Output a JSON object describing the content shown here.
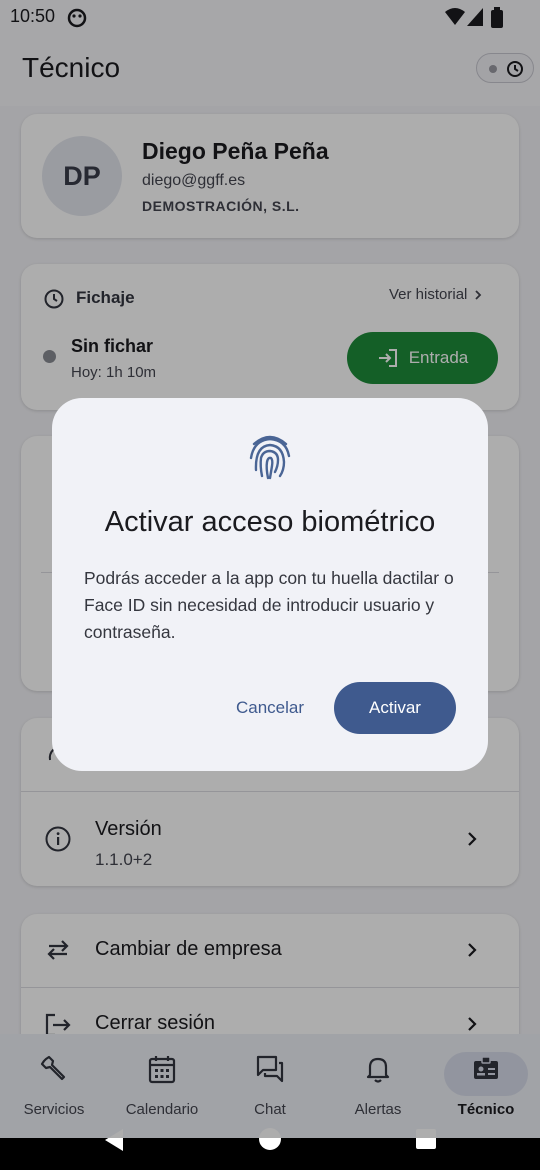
{
  "status_bar": {
    "time": "10:50"
  },
  "app_bar": {
    "title": "Técnico"
  },
  "profile": {
    "initials": "DP",
    "name": "Diego Peña Peña",
    "email": "diego@ggff.es",
    "company": "DEMOSTRACIÓN, S.L."
  },
  "fichaje": {
    "title": "Fichaje",
    "history_link": "Ver historial",
    "status": "Sin fichar",
    "today": "Hoy: 1h 10m",
    "entry_button": "Entrada",
    "entry_color": "#1e8c3a"
  },
  "version": {
    "label": "Versión",
    "value": "1.1.0+2"
  },
  "actions": {
    "change_company": "Cambiar de empresa",
    "logout": "Cerrar sesión"
  },
  "nav": {
    "items": [
      {
        "label": "Servicios",
        "icon": "wrench-icon"
      },
      {
        "label": "Calendario",
        "icon": "calendar-icon"
      },
      {
        "label": "Chat",
        "icon": "chat-icon"
      },
      {
        "label": "Alertas",
        "icon": "bell-icon"
      },
      {
        "label": "Técnico",
        "icon": "badge-icon",
        "active": true
      }
    ]
  },
  "dialog": {
    "icon": "fingerprint-icon",
    "title": "Activar acceso biométrico",
    "body": "Podrás acceder a la app con tu huella dactilar o Face ID sin necesidad de introducir usuario y contraseña.",
    "cancel": "Cancelar",
    "confirm": "Activar",
    "accent_color": "#3f5a8e"
  }
}
